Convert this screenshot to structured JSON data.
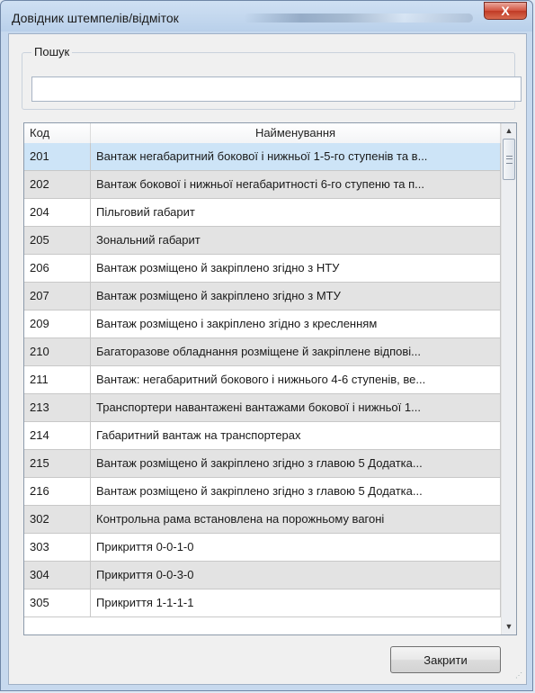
{
  "window": {
    "title": "Довідник штемпелів/відміток",
    "close_glyph": "X"
  },
  "search": {
    "group_label": "Пошук",
    "value": "",
    "placeholder": ""
  },
  "table": {
    "columns": [
      "Код",
      "Найменування"
    ],
    "selected_row": 0,
    "rows": [
      {
        "code": "201",
        "name": "Вантаж негабаритний бокової і нижньої 1-5-го ступенів та в..."
      },
      {
        "code": "202",
        "name": "Вантаж бокової і нижньої негабаритності 6-го ступеню та п..."
      },
      {
        "code": "204",
        "name": "Пільговий габарит"
      },
      {
        "code": "205",
        "name": "Зональний габарит"
      },
      {
        "code": "206",
        "name": "Вантаж розміщено й закріплено  згідно з НТУ"
      },
      {
        "code": "207",
        "name": "Вантаж розміщено й закріплено  згідно з МТУ"
      },
      {
        "code": "209",
        "name": "Вантаж розміщено і закріплено згідно з  кресленням"
      },
      {
        "code": "210",
        "name": "Багаторазове обладнання розміщене й закріплене  відпові..."
      },
      {
        "code": "211",
        "name": "Вантаж: негабаритний бокового і нижнього 4-6 ступенів, ве..."
      },
      {
        "code": "213",
        "name": "Транспортери навантажені  вантажами бокової і нижньої 1..."
      },
      {
        "code": "214",
        "name": "Габаритний вантаж на транспортерах"
      },
      {
        "code": "215",
        "name": "Вантаж розміщено й закріплено згідно з главою 5 Додатка..."
      },
      {
        "code": "216",
        "name": "Вантаж розміщено й закріплено згідно з главою 5 Додатка..."
      },
      {
        "code": "302",
        "name": "Контрольна рама встановлена на порожньому вагоні"
      },
      {
        "code": "303",
        "name": "Прикриття 0-0-1-0"
      },
      {
        "code": "304",
        "name": "Прикриття 0-0-3-0"
      },
      {
        "code": "305",
        "name": "Прикриття 1-1-1-1"
      }
    ]
  },
  "footer": {
    "close_label": "Закрити"
  },
  "icons": {
    "scroll_up": "scroll-up-arrow-icon",
    "scroll_down": "scroll-down-arrow-icon",
    "close": "close-icon"
  },
  "colors": {
    "selected_row": "#cde4f7",
    "alt_row": "#e3e3e3",
    "close_button": "#c9402b"
  }
}
